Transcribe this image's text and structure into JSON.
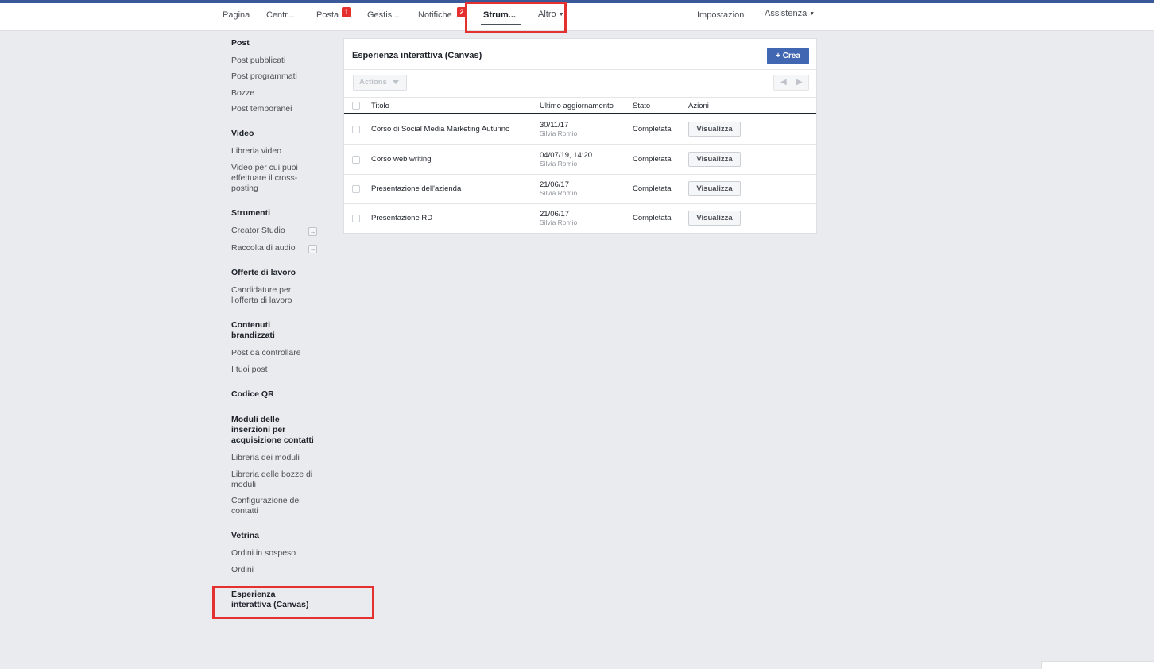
{
  "nav": {
    "pagina": "Pagina",
    "centro": "Centr...",
    "posta": "Posta",
    "posta_badge": "1",
    "gestisci": "Gestis...",
    "notifiche": "Notifiche",
    "notifiche_badge": "2",
    "strumenti": "Strum...",
    "altro": "Altro",
    "impostazioni": "Impostazioni",
    "assistenza": "Assistenza"
  },
  "sidebar": {
    "post_head": "Post",
    "post_pubblicati": "Post pubblicati",
    "post_programmati": "Post programmati",
    "bozze": "Bozze",
    "post_temporanei": "Post temporanei",
    "video_head": "Video",
    "libreria_video": "Libreria video",
    "video_crosspost_1": "Video per cui puoi",
    "video_crosspost_2": "effettuare il cross-",
    "video_crosspost_3": "posting",
    "strumenti_head": "Strumenti",
    "creator_studio": "Creator Studio",
    "raccolta_audio": "Raccolta di audio",
    "offerte_head": "Offerte di lavoro",
    "candidature_1": "Candidature per",
    "candidature_2": "l'offerta di lavoro",
    "contenuti_head_1": "Contenuti",
    "contenuti_head_2": "brandizzati",
    "post_controllare": "Post da controllare",
    "tuoi_post": "I tuoi post",
    "codice_qr": "Codice QR",
    "moduli_head_1": "Moduli delle",
    "moduli_head_2": "inserzioni per",
    "moduli_head_3": "acquisizione contatti",
    "libreria_moduli": "Libreria dei moduli",
    "libreria_bozze_1": "Libreria delle bozze di",
    "libreria_bozze_2": "moduli",
    "config_contatti_1": "Configurazione dei",
    "config_contatti_2": "contatti",
    "vetrina_head": "Vetrina",
    "ordini_sospeso": "Ordini in sospeso",
    "ordini": "Ordini",
    "canvas_1": "Esperienza",
    "canvas_2": "interattiva (Canvas)"
  },
  "panel": {
    "title": "Esperienza interattiva (Canvas)",
    "crea_label": "Crea",
    "actions_label": "Actions",
    "columns": {
      "titolo": "Titolo",
      "aggiornamento": "Ultimo aggiornamento",
      "stato": "Stato",
      "azioni": "Azioni"
    },
    "rows": [
      {
        "titolo": "Corso di Social Media Marketing Autunno",
        "data": "30/11/17",
        "autore": "Silvia Romio",
        "stato": "Completata",
        "azione": "Visualizza"
      },
      {
        "titolo": "Corso web writing",
        "data": "04/07/19, 14:20",
        "autore": "Silvia Romio",
        "stato": "Completata",
        "azione": "Visualizza"
      },
      {
        "titolo": "Presentazione dell'azienda",
        "data": "21/06/17",
        "autore": "Silvia Romio",
        "stato": "Completata",
        "azione": "Visualizza"
      },
      {
        "titolo": "Presentazione RD",
        "data": "21/06/17",
        "autore": "Silvia Romio",
        "stato": "Completata",
        "azione": "Visualizza"
      }
    ]
  },
  "colors": {
    "accent": "#4267b2",
    "highlight": "#e4312f",
    "background": "#e9ebee"
  },
  "icons": {
    "crea": "plus-icon",
    "actions": "caret-down-icon",
    "pager_prev": "chevron-left-icon",
    "pager_next": "chevron-right-icon",
    "external": "external-link-icon"
  }
}
